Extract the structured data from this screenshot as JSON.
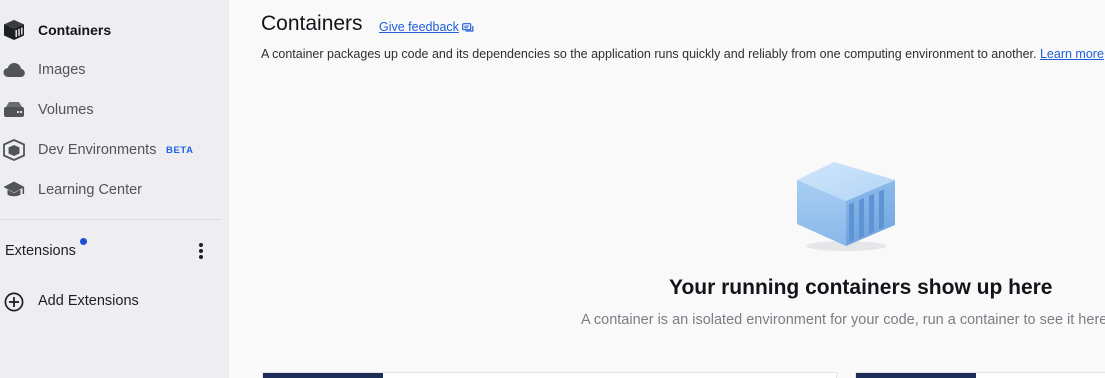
{
  "sidebar": {
    "items": [
      {
        "label": "Containers",
        "icon": "container-icon",
        "active": true
      },
      {
        "label": "Images",
        "icon": "cloud-icon"
      },
      {
        "label": "Volumes",
        "icon": "volume-icon"
      },
      {
        "label": "Dev Environments",
        "icon": "dev-env-icon",
        "badge": "BETA"
      },
      {
        "label": "Learning Center",
        "icon": "graduation-cap-icon"
      }
    ],
    "extensions": {
      "label": "Extensions",
      "add_label": "Add Extensions"
    }
  },
  "main": {
    "title": "Containers",
    "feedback_label": "Give feedback",
    "description": "A container packages up code and its dependencies so the application runs quickly and reliably from one computing environment to another.",
    "learn_more": "Learn more",
    "empty_state": {
      "title": "Your running containers show up here",
      "subtitle": "A container is an isolated environment for your code, run a container to see it here."
    }
  },
  "colors": {
    "sidebar_bg": "#eeeef0",
    "main_bg": "#f9f9fa",
    "accent": "#1d63ed",
    "link": "#2060d6",
    "card_strip": "#1c2e58"
  }
}
